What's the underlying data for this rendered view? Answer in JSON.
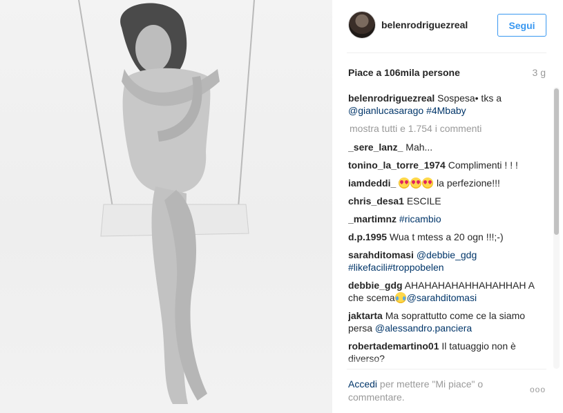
{
  "post": {
    "username": "belenrodriguezreal",
    "follow_label": "Segui",
    "likes": "Piace a 106mila persone",
    "time_ago": "3 g"
  },
  "caption": {
    "user": "belenrodriguezreal",
    "text": "Sospesa• tks a",
    "tag1": "@gianlucasarago",
    "tag2": "#4Mbaby"
  },
  "show_all_comments": "mostra tutti e 1.754 i commenti",
  "comments": [
    {
      "user": "_sere_lanz_",
      "text": "Mah..."
    },
    {
      "user": "tonino_la_torre_1974",
      "text": "Complimenti ! ! !"
    },
    {
      "user": "iamdeddi_",
      "text": "la perfezione!!!"
    },
    {
      "user": "chris_desa1",
      "text": "ESCILE"
    },
    {
      "user": "_martimnz",
      "text": "#ricambio"
    },
    {
      "user": "d.p.1995",
      "text": "Wua t mtess a 20 ogn !!!;-)"
    },
    {
      "user": "sarahditomasi",
      "tag": "@debbie_gdg",
      "tag2": "#likefacili",
      "tag3": "#troppobelen"
    },
    {
      "user": "debbie_gdg",
      "text": "AHAHAHAHAHHAHAHHAH A che scema",
      "tag": "@sarahditomasi"
    },
    {
      "user": "jaktarta",
      "text": "Ma soprattutto come ce la siamo persa",
      "tag": "@alessandro.panciera"
    },
    {
      "user": "robertademartino01",
      "text": "Il tatuaggio non è diverso?"
    }
  ],
  "footer": {
    "login": "Accedi",
    "text": "per mettere \"Mi piace\" o commentare.",
    "more": "ooo"
  },
  "colors": {
    "link": "#003569",
    "follow": "#3897f0",
    "muted": "#999999"
  },
  "icons": [
    "more-options-icon",
    "emoji-heart-eyes-icon",
    "emoji-laughing-icon"
  ]
}
